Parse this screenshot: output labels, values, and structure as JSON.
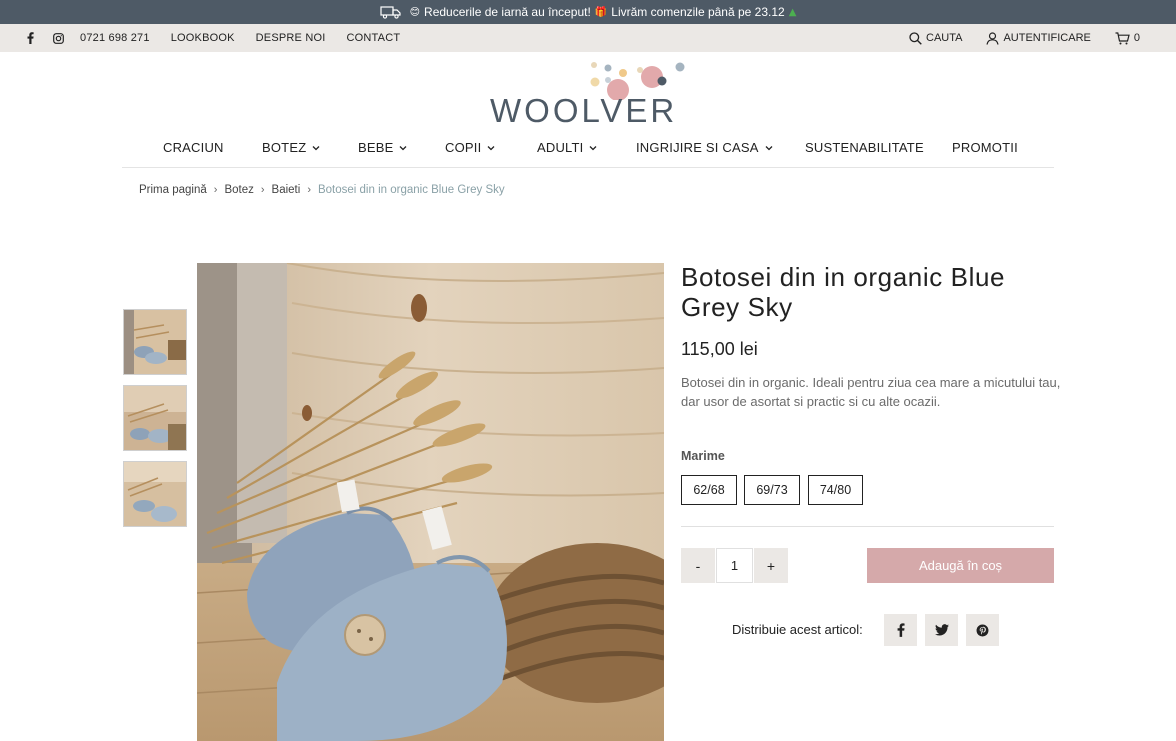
{
  "announcement": {
    "text_part1": "Reducerile de iarnă au început!",
    "text_part2": "Livrăm comenzile până pe 23.12",
    "icons": [
      "truck-icon",
      "emoji-icon",
      "gift-icon",
      "tree-icon"
    ]
  },
  "utility": {
    "phone": "0721 698 271",
    "lookbook": "LOOKBOOK",
    "about": "DESPRE NOI",
    "contact": "CONTACT",
    "search": "CAUTA",
    "login": "AUTENTIFICARE",
    "cart_count": "0"
  },
  "logo": {
    "text": "WOOLVER"
  },
  "nav": [
    {
      "label": "CRACIUN",
      "has_dropdown": false
    },
    {
      "label": "BOTEZ",
      "has_dropdown": true
    },
    {
      "label": "BEBE",
      "has_dropdown": true
    },
    {
      "label": "COPII",
      "has_dropdown": true
    },
    {
      "label": "ADULTI",
      "has_dropdown": true
    },
    {
      "label": "INGRIJIRE SI CASA",
      "has_dropdown": true
    },
    {
      "label": "SUSTENABILITATE",
      "has_dropdown": false
    },
    {
      "label": "PROMOTII",
      "has_dropdown": false
    }
  ],
  "breadcrumb": [
    "Prima pagină",
    "Botez",
    "Baieti",
    "Botosei din in organic Blue Grey Sky"
  ],
  "product": {
    "title": "Botosei din in organic Blue Grey Sky",
    "price": "115,00 lei",
    "description": "Botosei din in organic. Ideali pentru ziua cea mare a micutului tau, dar usor de asortat si practic si cu alte ocazii.",
    "size_label": "Marime",
    "sizes": [
      "62/68",
      "69/73",
      "74/80"
    ],
    "quantity": "1",
    "qty_minus": "-",
    "qty_plus": "+",
    "add_to_cart": "Adaugă în coș",
    "share_label": "Distribuie acest articol:"
  },
  "colors": {
    "announce_bg": "#4e5a66",
    "utility_bg": "#ebe8e5",
    "add_to_cart_bg": "#d5a9aa",
    "breadcrumb_current": "#8aa1a7",
    "logo_text": "#4e5a66"
  }
}
